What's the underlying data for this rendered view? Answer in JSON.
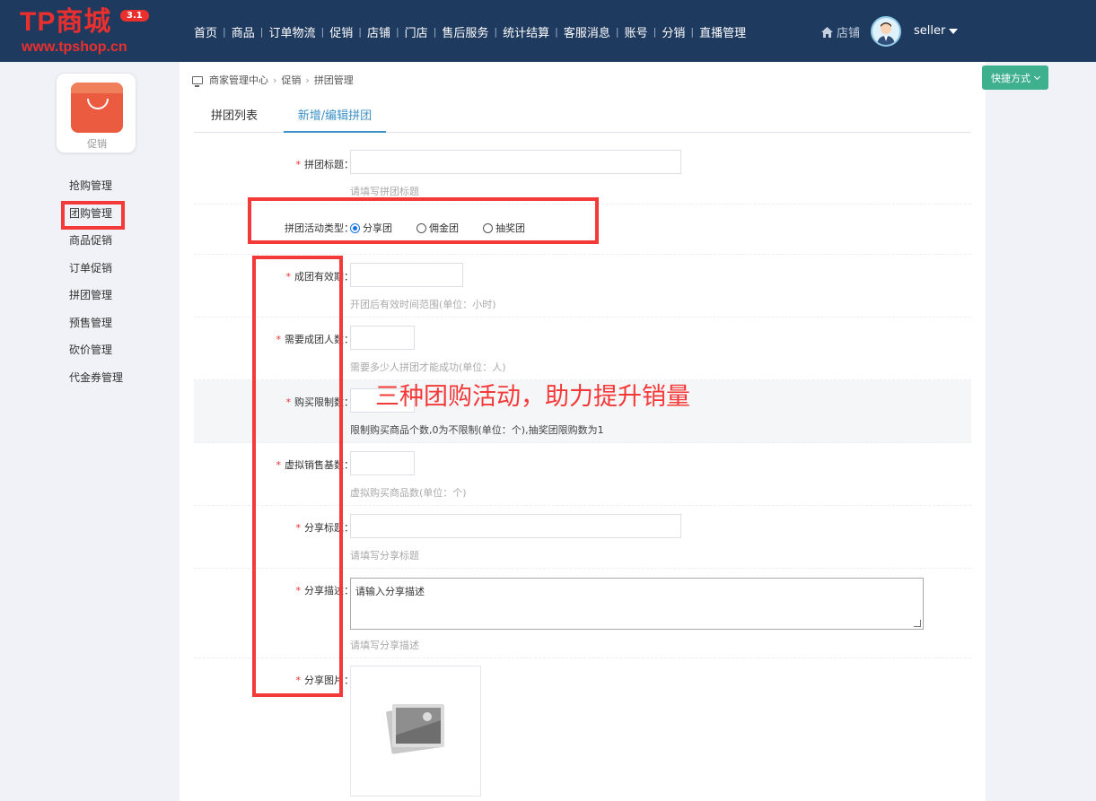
{
  "header": {
    "logo_main": "TP商城",
    "logo_sub": "www.tpshop.cn",
    "version": "3.1",
    "nav": [
      "首页",
      "商品",
      "订单物流",
      "促销",
      "店铺",
      "门店",
      "售后服务",
      "统计结算",
      "客服消息",
      "账号",
      "分销",
      "直播管理"
    ],
    "store_label": "店铺",
    "username": "seller"
  },
  "sidebar": {
    "card_label": "促销",
    "items": [
      "抢购管理",
      "团购管理",
      "商品促销",
      "订单促销",
      "拼团管理",
      "预售管理",
      "砍价管理",
      "代金券管理"
    ]
  },
  "breadcrumb": [
    "商家管理中心",
    "促销",
    "拼团管理"
  ],
  "quick_button": "快捷方式",
  "tabs": [
    "拼团列表",
    "新增/编辑拼团"
  ],
  "form": {
    "title_label": "拼团标题：",
    "title_hint": "请填写拼团标题",
    "type_label": "拼团活动类型：",
    "type_options": [
      "分享团",
      "佣金团",
      "抽奖团"
    ],
    "type_selected": "分享团",
    "validity_label": "成团有效期：",
    "validity_hint": "开团后有效时间范围(单位：小时)",
    "people_label": "需要成团人数：",
    "people_hint": "需要多少人拼团才能成功(单位：人)",
    "limit_label": "购买限制数：",
    "limit_hint": "限制购买商品个数,0为不限制(单位：个),抽奖团限购数为1",
    "virtual_label": "虚拟销售基数：",
    "virtual_hint": "虚拟购买商品数(单位：个)",
    "share_title_label": "分享标题：",
    "share_title_hint": "请填写分享标题",
    "share_desc_label": "分享描述：",
    "share_desc_placeholder": "请输入分享描述",
    "share_desc_hint": "请填写分享描述",
    "share_image_label": "分享图片："
  },
  "annotation": "三种团购活动，助力提升销量",
  "colors": {
    "header_bg": "#1f3a5f",
    "accent": "#3c91c7",
    "highlight": "#f43939",
    "quick_button": "#3fb08d"
  }
}
